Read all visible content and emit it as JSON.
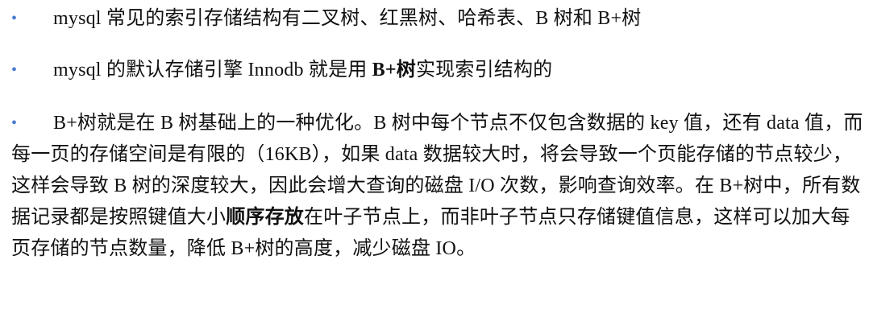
{
  "bullets": {
    "b1": "•",
    "b2": "•",
    "b3": "•"
  },
  "items": {
    "i1": {
      "text": "mysql 常见的索引存储结构有二叉树、红黑树、哈希表、B 树和 B+树"
    },
    "i2": {
      "pre": "mysql 的默认存储引擎 Innodb 就是用 ",
      "bold": "B+树",
      "post": "实现索引结构的"
    },
    "i3": {
      "pre": "B+树就是在 B 树基础上的一种优化。B 树中每个节点不仅包含数据的 key 值，还有 data 值，而每一页的存储空间是有限的（16KB），如果 data 数据较大时，将会导致一个页能存储的节点较少，这样会导致 B 树的深度较大，因此会增大查询的磁盘 I/O 次数，影响查询效率。在 B+树中，所有数据记录都是按照键值大小",
      "bold": "顺序存放",
      "post": "在叶子节点上，而非叶子节点只存储键值信息，这样可以加大每页存储的节点数量，降低 B+树的高度，减少磁盘 IO。"
    }
  },
  "colors": {
    "bullet": "#4a7bd0",
    "text": "#111111"
  }
}
